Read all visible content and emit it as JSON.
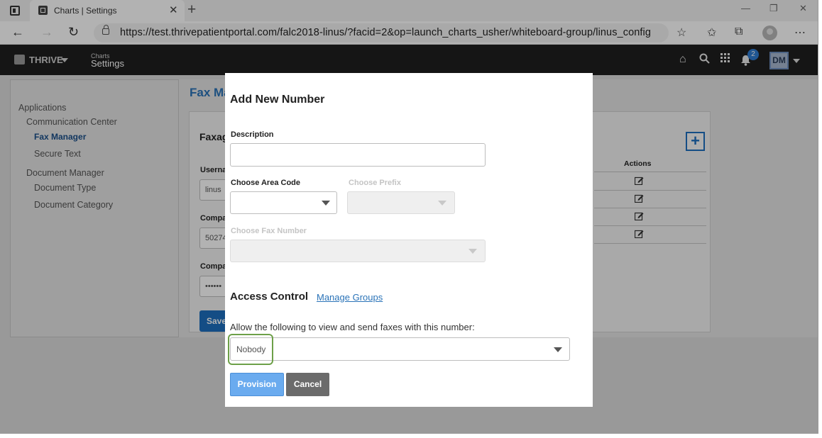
{
  "browser": {
    "tab_title": "Charts | Settings",
    "url": "https://test.thrivepatientportal.com/falc2018-linus/?facid=2&op=launch_charts_usher/whiteboard-group/linus_config"
  },
  "header": {
    "logo": "THRIVE",
    "section_small": "Charts",
    "section_big": "Settings",
    "notification_count": "2",
    "user_initials": "DM"
  },
  "sidebar": {
    "applications": "Applications",
    "communication_center": "Communication Center",
    "fax_manager": "Fax Manager",
    "secure_text": "Secure Text",
    "document_manager": "Document Manager",
    "document_type": "Document Type",
    "document_category": "Document Category"
  },
  "main": {
    "page_title": "Fax Ma",
    "card_title": "Faxag",
    "username_label": "Userna",
    "username_value": "linus",
    "company_label_1": "Compa",
    "company_value_1": "50274",
    "company_label_2": "Compa",
    "company_value_2": "••••••",
    "save_label": "Save",
    "actions_header": "Actions",
    "add_icon": "plus-icon",
    "edit_icon": "edit-icon"
  },
  "modal": {
    "title": "Add New Number",
    "description_label": "Description",
    "description_value": "",
    "area_code_label": "Choose Area Code",
    "prefix_label": "Choose Prefix",
    "fax_number_label": "Choose Fax Number",
    "access_control_title": "Access Control",
    "manage_groups_link": "Manage Groups",
    "allow_text": "Allow the following to view and send faxes with this number:",
    "access_value": "Nobody",
    "provision_label": "Provision",
    "cancel_label": "Cancel"
  },
  "colors": {
    "accent": "#2a73b8",
    "primary_button": "#6aabef",
    "highlight": "#6da048",
    "header_bg": "#1f1f1f"
  }
}
